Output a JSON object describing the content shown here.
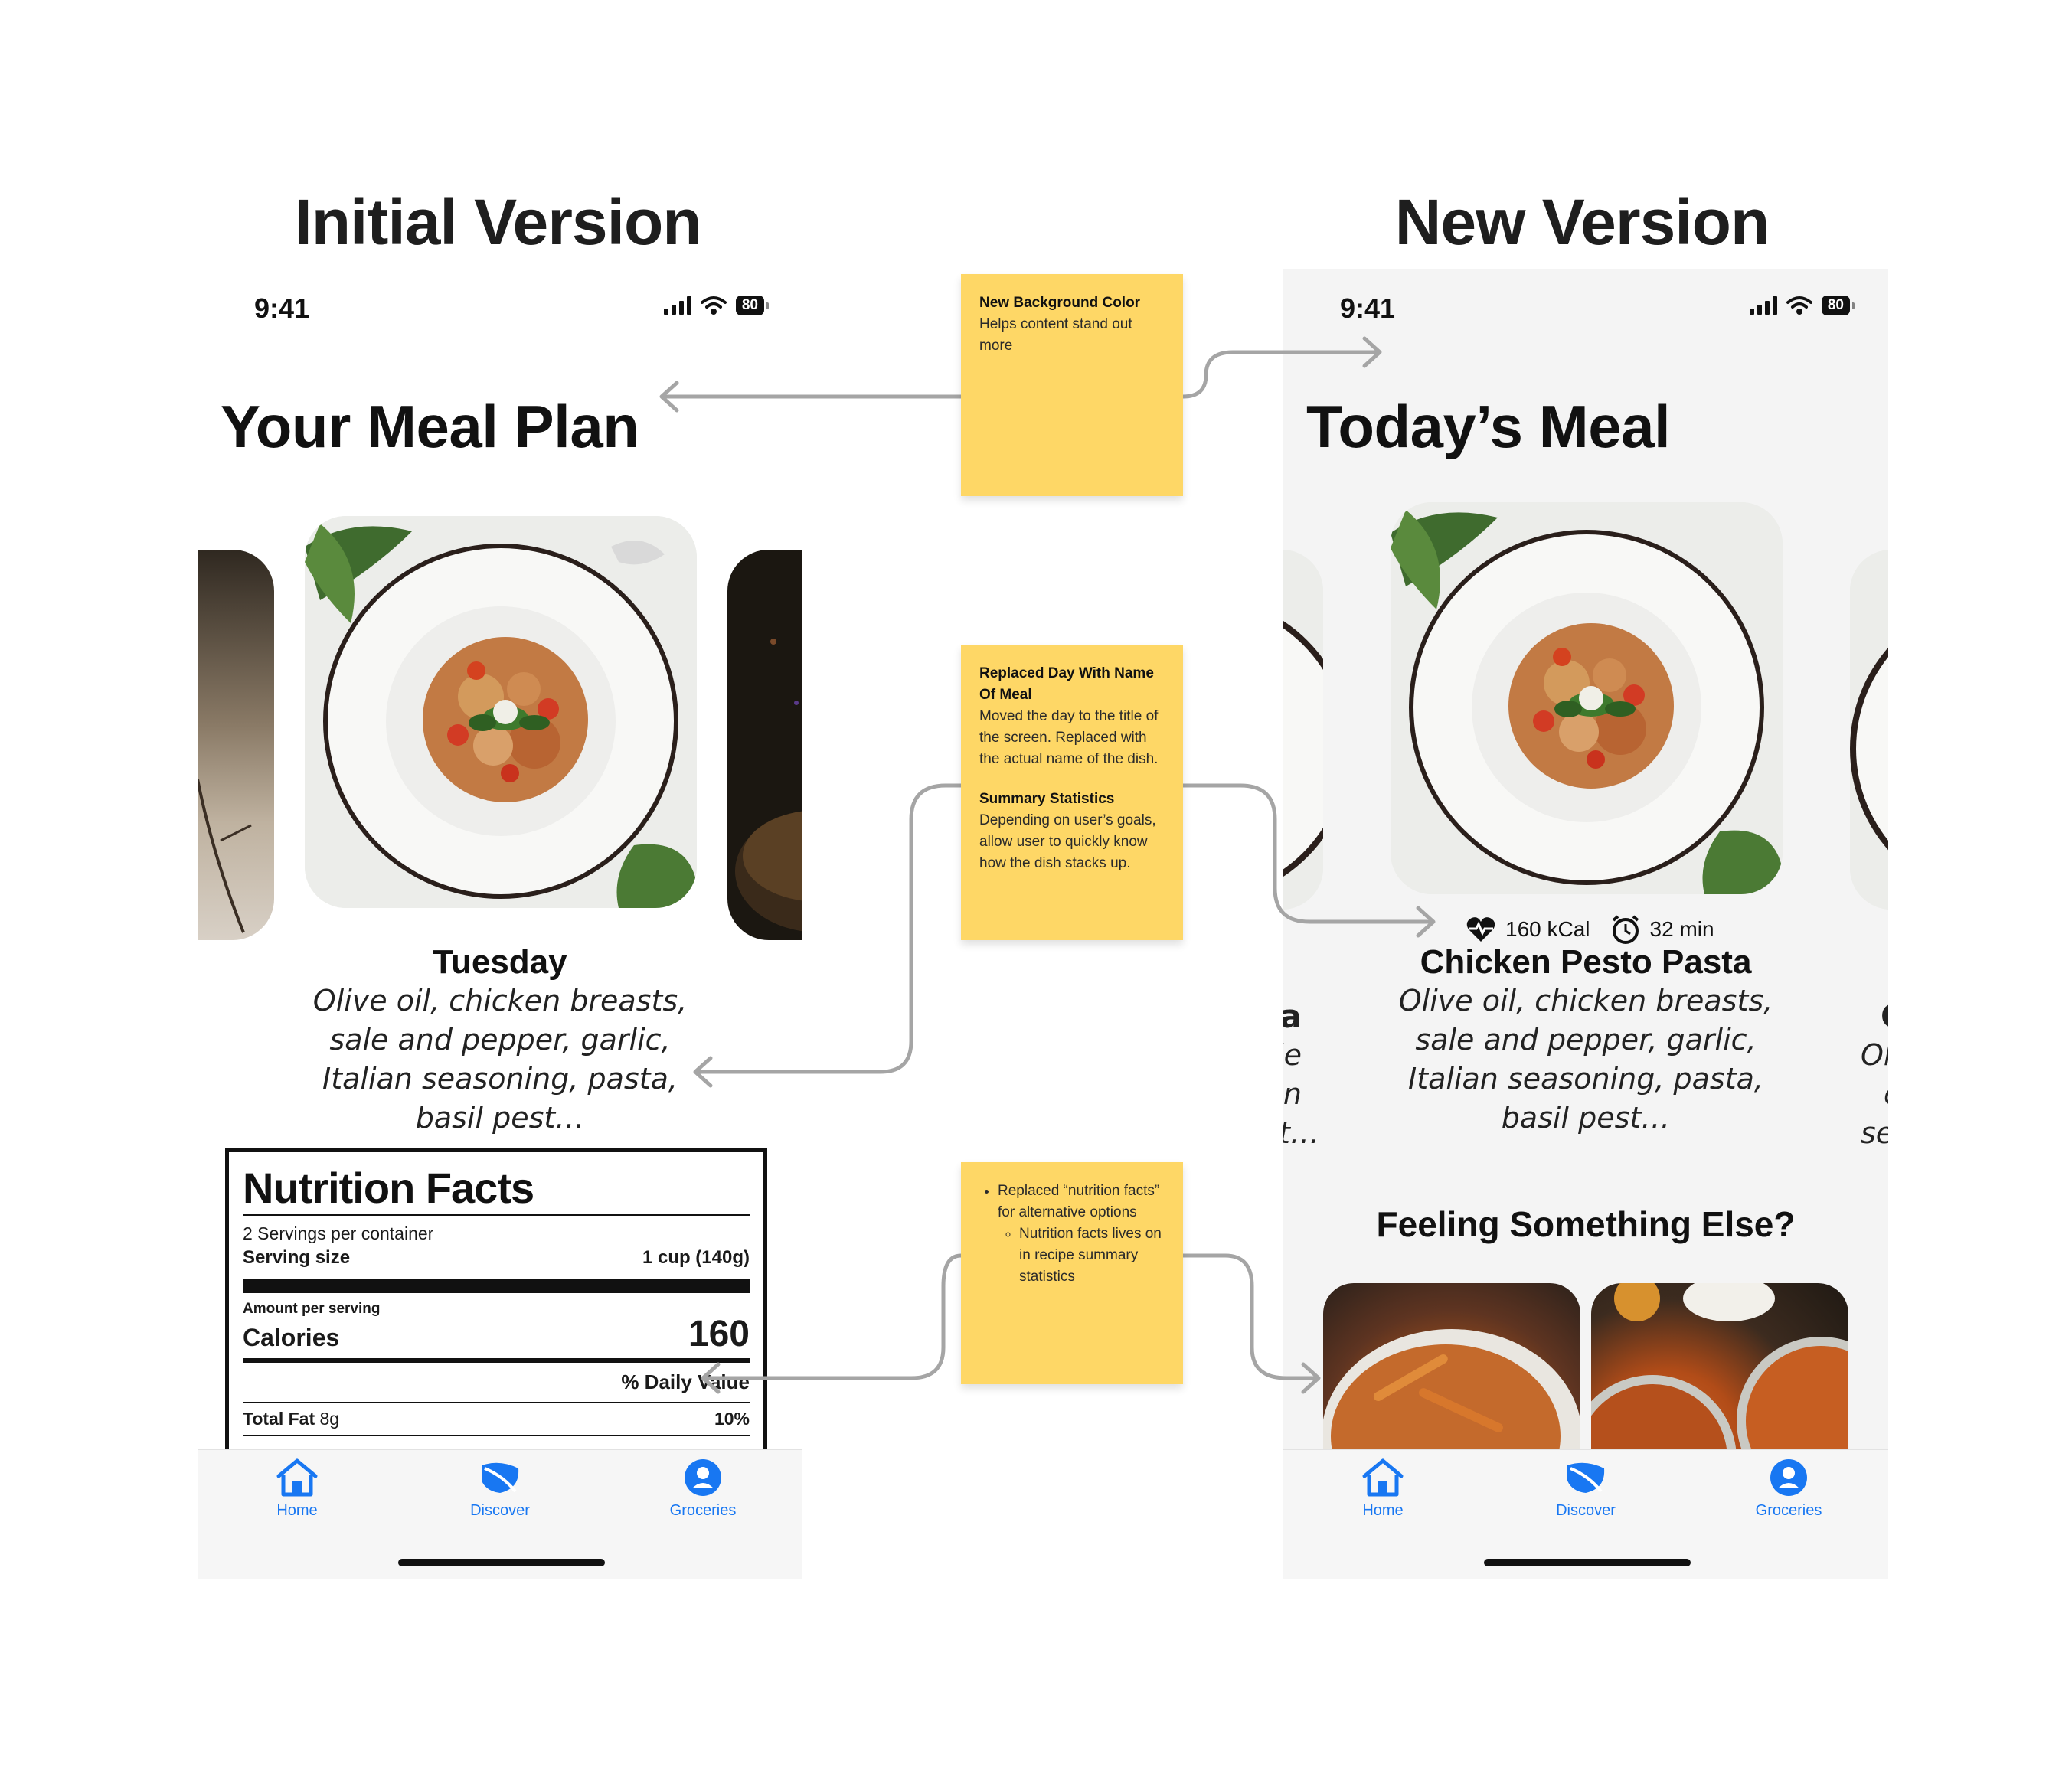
{
  "headings": {
    "initial": "Initial Version",
    "new": "New Version"
  },
  "initial": {
    "status": {
      "time": "9:41",
      "battery": "80"
    },
    "title": "Your Meal Plan",
    "day": "Tuesday",
    "ingredients": "Olive oil, chicken breasts, sale and pepper, garlic, Italian seasoning, pasta, basil pest…",
    "nutrition": {
      "title": "Nutrition Facts",
      "servings": "2 Servings per container",
      "serving_size_label": "Serving size",
      "serving_size_value": "1 cup (140g)",
      "amount_label": "Amount per serving",
      "calories_label": "Calories",
      "calories_value": "160",
      "daily_value_label": "% Daily Value",
      "total_fat_label": "Total Fat",
      "total_fat_amount": "8g",
      "total_fat_pct": "10%"
    },
    "tabs": [
      {
        "label": "Home",
        "icon": "house-icon"
      },
      {
        "label": "Discover",
        "icon": "leaf-icon"
      },
      {
        "label": "Groceries",
        "icon": "person-circle-icon"
      }
    ]
  },
  "new": {
    "status": {
      "time": "9:41",
      "battery": "80"
    },
    "title": "Today’s Meal",
    "stats": {
      "calories": "160 kCal",
      "time": "32 min"
    },
    "meal_name": "Chicken Pesto Pasta",
    "ingredients": "Olive oil, chicken breasts, sale and pepper, garlic, Italian seasoning, pasta, basil pest…",
    "left_peek_lines": [
      "a",
      "ale",
      "n",
      "t…"
    ],
    "right_peek_lines": [
      "C",
      "Oli",
      "c",
      "sea"
    ],
    "section_title": "Feeling Something Else?",
    "tabs": [
      {
        "label": "Home",
        "icon": "house-icon"
      },
      {
        "label": "Discover",
        "icon": "leaf-icon"
      },
      {
        "label": "Groceries",
        "icon": "person-circle-icon"
      }
    ]
  },
  "notes": {
    "background": {
      "title": "New Background Color",
      "body": "Helps content stand out more"
    },
    "meal_name": {
      "title": "Replaced Day With Name Of Meal",
      "body": "Moved the day to the title of the screen. Replaced with the actual name of the dish.",
      "title2": "Summary Statistics",
      "body2": "Depending on user’s goals, allow user to quickly know how the dish stacks up."
    },
    "nutrition": {
      "bullet": "Replaced “nutrition facts” for alternative options",
      "sub_bullet": "Nutrition facts lives on in recipe summary statistics"
    }
  },
  "colors": {
    "accent": "#1877f2",
    "sticky": "#fed766",
    "new_bg": "#f4f4f4"
  }
}
